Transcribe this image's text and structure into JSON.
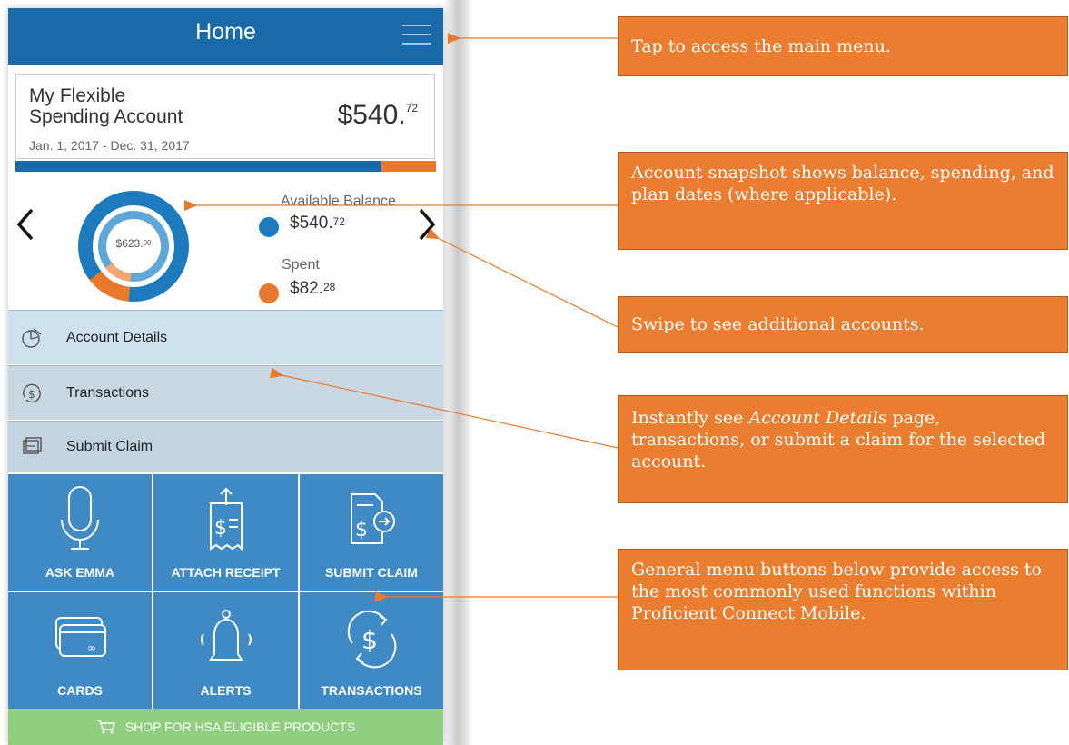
{
  "app": {
    "header_title": "Home"
  },
  "account": {
    "name_line1": "My Flexible",
    "name_line2": "Spending Account",
    "dates": "Jan. 1, 2017 - Dec. 31, 2017",
    "balance_main": "$540.",
    "balance_cents": "72",
    "progress_fraction": 0.87
  },
  "snapshot": {
    "donut_total_main": "$623.",
    "donut_total_cents": "00",
    "available_label": "Available Balance",
    "available_main": "$540.",
    "available_cents": "72",
    "spent_label": "Spent",
    "spent_main": "$82.",
    "spent_cents": "28",
    "spent_fraction": 0.132
  },
  "rows": [
    {
      "label": "Account Details",
      "icon": "account-details-icon"
    },
    {
      "label": "Transactions",
      "icon": "transactions-dollar-icon"
    },
    {
      "label": "Submit Claim",
      "icon": "submit-claim-icon"
    }
  ],
  "tiles": [
    {
      "label": "ASK EMMA",
      "icon": "microphone-icon"
    },
    {
      "label": "ATTACH RECEIPT",
      "icon": "receipt-icon"
    },
    {
      "label": "SUBMIT CLAIM",
      "icon": "claim-document-icon"
    },
    {
      "label": "CARDS",
      "icon": "cards-icon"
    },
    {
      "label": "ALERTS",
      "icon": "bell-icon"
    },
    {
      "label": "TRANSACTIONS",
      "icon": "dollar-cycle-icon"
    }
  ],
  "shop_label": "SHOP FOR HSA ELIGIBLE PRODUCTS",
  "callouts": [
    "Tap to access the main menu.",
    "Account snapshot shows balance, spending, and plan dates (where applicable).",
    "Swipe to see additional accounts.",
    {
      "emphasis": "Account Details",
      "before": "Instantly see ",
      "after": " page, transactions, or submit a claim for the selected account."
    },
    "General menu buttons below provide access to the most commonly used functions within Proficient Connect Mobile."
  ],
  "colors": {
    "header": "#1a6aa9",
    "tile": "#3f8ac4",
    "row_light": "#cde1ef",
    "row_mid": "#c9d7e2",
    "callout": "#ea7d30",
    "shop": "#8fcf7f",
    "available": "#1d7bbd",
    "spent": "#e8792d"
  }
}
